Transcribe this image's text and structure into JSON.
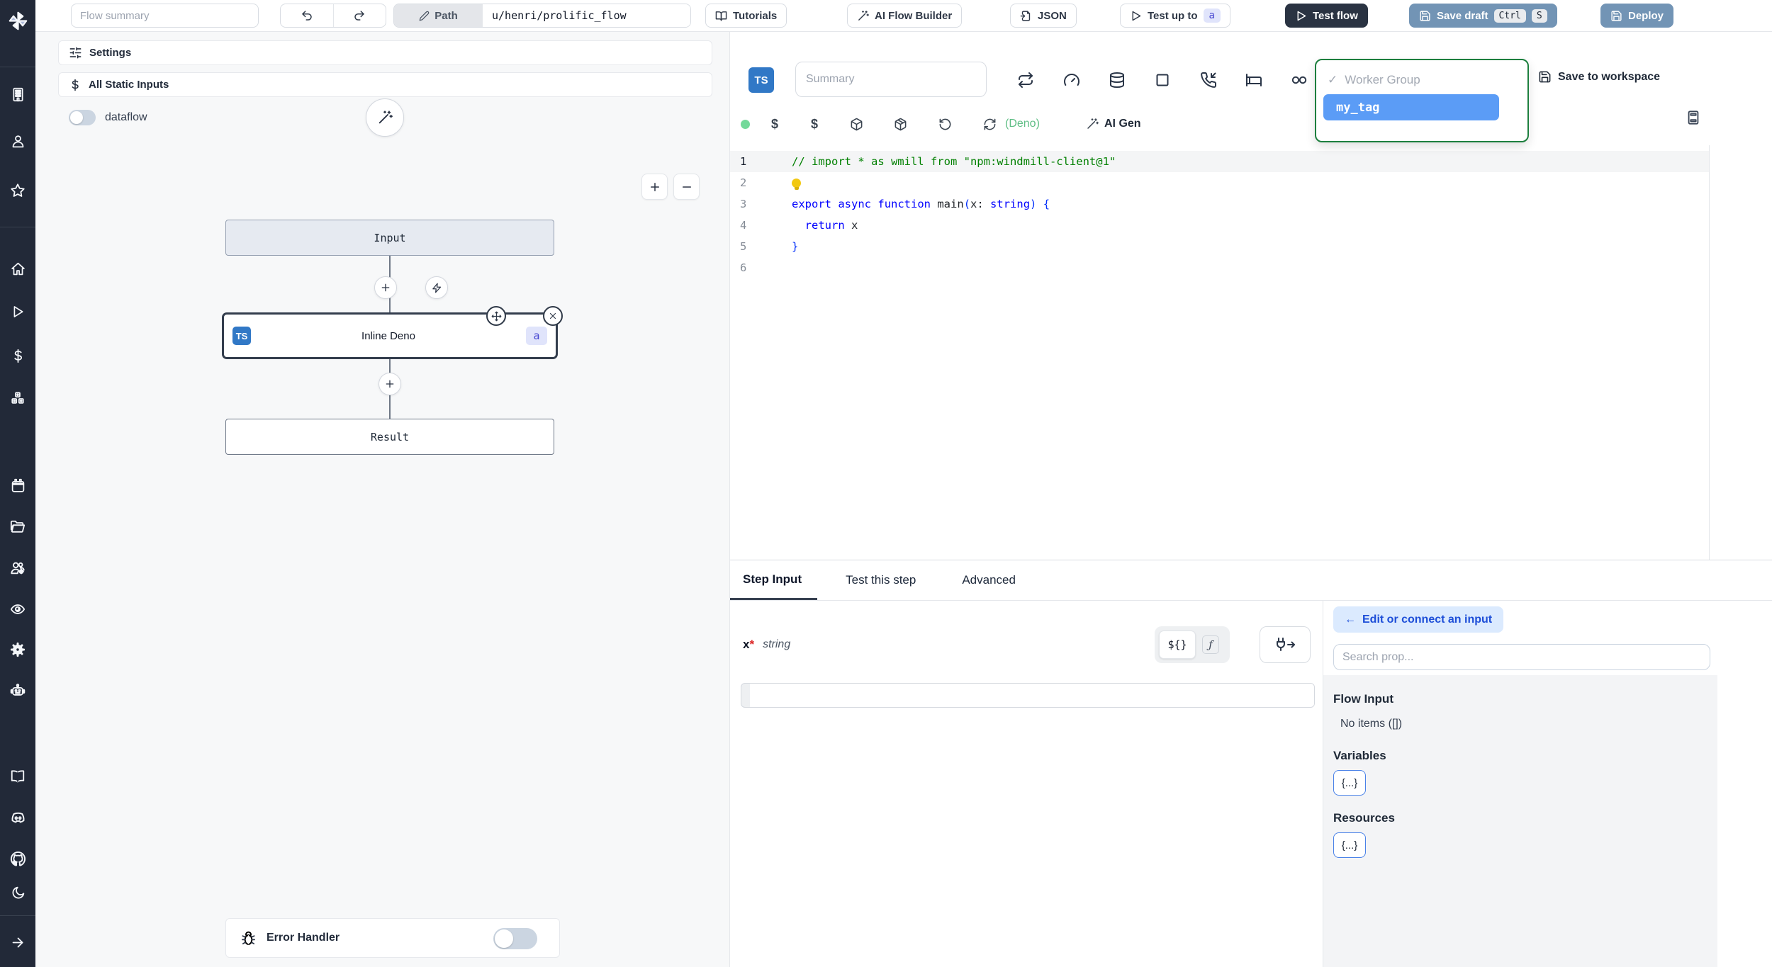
{
  "colors": {
    "sidebar-bg": "#222938",
    "topbar-dark-btn": "#2a3342",
    "steel-btn": "#7294b5",
    "ts-badge": "#3178c6",
    "indigo-badge-bg": "#e0e4fb",
    "indigo-badge-text": "#4747d1",
    "dropdown-green": "#1d7f3e",
    "tag-selected-bg": "#5b9cf6",
    "code-comment": "#008000",
    "code-keyword": "#0000ff",
    "code-brace": "#0431fa",
    "deno-green": "#5fbe85",
    "chip-blue-bg": "#dbeafe",
    "chip-blue-text": "#1d4ed8",
    "object-badge-border": "#4a82e8",
    "status-dot-green": "#74d99a"
  },
  "sidebar": {
    "icons": [
      "windmill-logo",
      "building",
      "user",
      "star",
      "home",
      "play",
      "dollar",
      "boxes",
      "calendar",
      "folder-open",
      "users-cog",
      "eye",
      "settings-gear",
      "robot",
      "book",
      "discord",
      "github",
      "moon",
      "arrow-right"
    ]
  },
  "topbar": {
    "flow_summary_placeholder": "Flow summary",
    "path_label": "Path",
    "path_value": "u/henri/prolific_flow",
    "tutorials_label": "Tutorials",
    "ai_flow_builder_label": "AI Flow Builder",
    "json_label": "JSON",
    "test_up_to_label": "Test up to",
    "test_up_to_badge": "a",
    "test_flow_label": "Test flow",
    "save_draft_label": "Save draft",
    "shortcut_keys": [
      "Ctrl",
      "S"
    ],
    "deploy_label": "Deploy"
  },
  "left_panel": {
    "settings_label": "Settings",
    "all_static_inputs_label": "All Static Inputs",
    "dataflow_label": "dataflow",
    "graph": {
      "input_node_label": "Input",
      "step_lang_badge": "TS",
      "step_node_label": "Inline Deno",
      "step_node_badge": "a",
      "result_node_label": "Result"
    },
    "error_handler_label": "Error Handler"
  },
  "editor": {
    "lang_badge": "TS",
    "summary_placeholder": "Summary",
    "worker_group_dropdown": {
      "check": "✓",
      "group_label": "Worker Group",
      "selected_tag": "my_tag"
    },
    "save_to_workspace_label": "Save to workspace",
    "toolbar": {
      "dollar1": "$",
      "dollar2": "$",
      "deno_label": "(Deno)",
      "ai_gen_label": "AI Gen"
    },
    "code_lines": [
      {
        "n": "1",
        "active": true,
        "tokens": [
          {
            "c": "comment",
            "t": "// import * as wmill from \"npm:windmill-client@1\""
          }
        ]
      },
      {
        "n": "2",
        "tokens": [
          {
            "c": "bulb",
            "t": ""
          }
        ]
      },
      {
        "n": "3",
        "tokens": [
          {
            "c": "kw",
            "t": "export"
          },
          {
            "c": "plain",
            "t": " "
          },
          {
            "c": "kw",
            "t": "async"
          },
          {
            "c": "plain",
            "t": " "
          },
          {
            "c": "kw",
            "t": "function"
          },
          {
            "c": "plain",
            "t": " main"
          },
          {
            "c": "brace",
            "t": "("
          },
          {
            "c": "plain",
            "t": "x"
          },
          {
            "c": "plain",
            "t": ": "
          },
          {
            "c": "kw",
            "t": "string"
          },
          {
            "c": "brace",
            "t": ")"
          },
          {
            "c": "plain",
            "t": " "
          },
          {
            "c": "brace",
            "t": "{"
          }
        ]
      },
      {
        "n": "4",
        "tokens": [
          {
            "c": "plain",
            "t": "  "
          },
          {
            "c": "kw",
            "t": "return"
          },
          {
            "c": "plain",
            "t": " x"
          }
        ]
      },
      {
        "n": "5",
        "tokens": [
          {
            "c": "brace",
            "t": "}"
          }
        ]
      },
      {
        "n": "6",
        "tokens": []
      }
    ]
  },
  "bottom_panel": {
    "tabs": [
      "Step Input",
      "Test this step",
      "Advanced"
    ],
    "active_tab": "Step Input",
    "field": {
      "name": "x",
      "required_mark": "*",
      "type": "string",
      "value": ""
    },
    "expr_toggle_label": "${}",
    "fn_toggle_label": "ƒ",
    "prop_picker": {
      "edit_connect_arrow": "←",
      "edit_connect_label": "Edit or connect an input",
      "search_placeholder": "Search prop...",
      "flow_input_title": "Flow Input",
      "flow_input_empty": "No items ([])",
      "variables_title": "Variables",
      "variables_badge": "{...}",
      "resources_title": "Resources",
      "resources_badge": "{...}"
    }
  }
}
